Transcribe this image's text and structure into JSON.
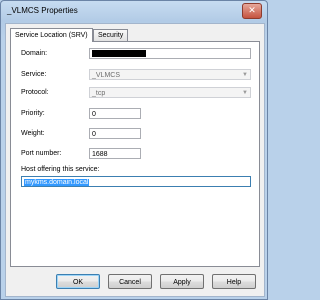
{
  "window": {
    "title": "_VLMCS Properties",
    "close_label": "✕"
  },
  "tabs": [
    {
      "label": "Service Location (SRV)",
      "active": true
    },
    {
      "label": "Security",
      "active": false
    }
  ],
  "form": {
    "domain_label": "Domain:",
    "domain_value": "",
    "service_label": "Service:",
    "service_value": "_VLMCS",
    "protocol_label": "Protocol:",
    "protocol_value": "_tcp",
    "priority_label": "Priority:",
    "priority_value": "0",
    "weight_label": "Weight:",
    "weight_value": "0",
    "port_label": "Port number:",
    "port_value": "1688",
    "host_label": "Host offering this service:",
    "host_value": "mykms.domain.local"
  },
  "buttons": {
    "ok": "OK",
    "cancel": "Cancel",
    "apply": "Apply",
    "help": "Help"
  },
  "colors": {
    "selection": "#3399ff",
    "redacted": "#000000"
  }
}
